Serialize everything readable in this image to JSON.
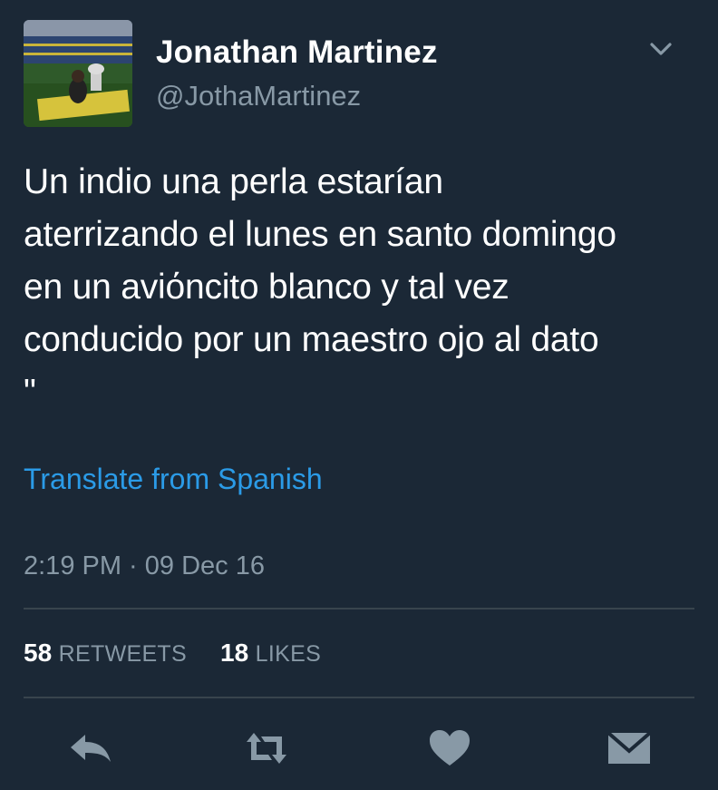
{
  "tweet": {
    "author_name": "Jonathan Martinez",
    "author_handle": "@JothaMartinez",
    "text": "Un indio una perla estarían\naterrizando el lunes en santo domingo\nen un aviόncito blanco y tal vez\nconducido por un maestro ojo al dato\n\"",
    "translate_label": "Translate from Spanish",
    "timestamp": "2:19 PM · 09 Dec 16"
  },
  "stats": {
    "retweets_count": "58",
    "retweets_label": "RETWEETS",
    "likes_count": "18",
    "likes_label": "LIKES"
  },
  "icons": {
    "more": "chevron-down-icon",
    "reply": "reply-icon",
    "retweet": "retweet-icon",
    "like": "heart-icon",
    "dm": "envelope-icon"
  },
  "colors": {
    "background": "#1b2836",
    "text": "#ffffff",
    "secondary": "#8899a6",
    "link": "#2b9be7",
    "divider": "#38444d",
    "icon": "#8899a6"
  }
}
